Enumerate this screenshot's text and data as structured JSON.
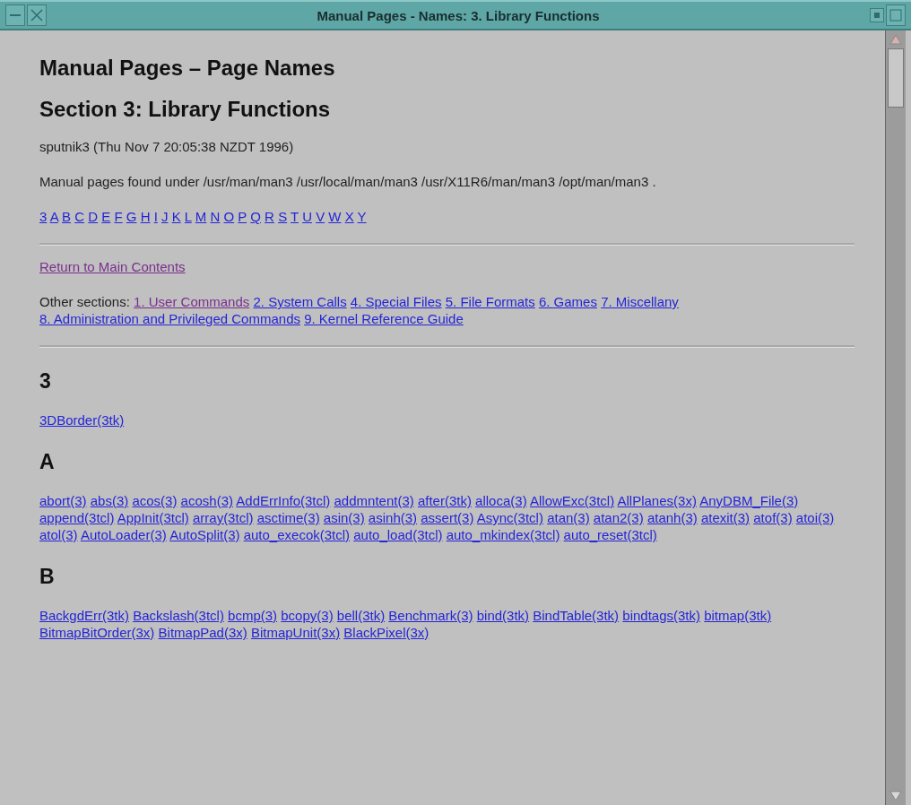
{
  "window": {
    "title": "Manual Pages - Names: 3. Library Functions"
  },
  "page": {
    "heading": "Manual Pages – Page Names",
    "subheading": "Section 3: Library Functions",
    "host_line": "sputnik3 (Thu Nov 7 20:05:38 NZDT 1996)",
    "paths_line": "Manual pages found under /usr/man/man3 /usr/local/man/man3 /usr/X11R6/man/man3 /opt/man/man3 .",
    "index_links": [
      "3",
      "A",
      "B",
      "C",
      "D",
      "E",
      "F",
      "G",
      "H",
      "I",
      "J",
      "K",
      "L",
      "M",
      "N",
      "O",
      "P",
      "Q",
      "R",
      "S",
      "T",
      "U",
      "V",
      "W",
      "X",
      "Y"
    ],
    "return_link": {
      "label": "Return to Main Contents",
      "visited": true
    },
    "other_sections": {
      "label": "Other sections:",
      "links": [
        {
          "label": "1. User Commands",
          "visited": true
        },
        {
          "label": "2. System Calls",
          "visited": false
        },
        {
          "label": "4. Special Files",
          "visited": false
        },
        {
          "label": "5. File Formats",
          "visited": false
        },
        {
          "label": "6. Games",
          "visited": false
        },
        {
          "label": "7. Miscellany",
          "visited": false
        },
        {
          "label": "8. Administration and Privileged Commands",
          "visited": false
        },
        {
          "label": "9. Kernel Reference Guide",
          "visited": false
        }
      ]
    },
    "groups": [
      {
        "letter": "3",
        "entries": [
          "3DBorder(3tk)"
        ]
      },
      {
        "letter": "A",
        "entries": [
          "abort(3)",
          "abs(3)",
          "acos(3)",
          "acosh(3)",
          "AddErrInfo(3tcl)",
          "addmntent(3)",
          "after(3tk)",
          "alloca(3)",
          "AllowExc(3tcl)",
          "AllPlanes(3x)",
          "AnyDBM_File(3)",
          "append(3tcl)",
          "AppInit(3tcl)",
          "array(3tcl)",
          "asctime(3)",
          "asin(3)",
          "asinh(3)",
          "assert(3)",
          "Async(3tcl)",
          "atan(3)",
          "atan2(3)",
          "atanh(3)",
          "atexit(3)",
          "atof(3)",
          "atoi(3)",
          "atol(3)",
          "AutoLoader(3)",
          "AutoSplit(3)",
          "auto_execok(3tcl)",
          "auto_load(3tcl)",
          "auto_mkindex(3tcl)",
          "auto_reset(3tcl)"
        ]
      },
      {
        "letter": "B",
        "entries": [
          "BackgdErr(3tk)",
          "Backslash(3tcl)",
          "bcmp(3)",
          "bcopy(3)",
          "bell(3tk)",
          "Benchmark(3)",
          "bind(3tk)",
          "BindTable(3tk)",
          "bindtags(3tk)",
          "bitmap(3tk)",
          "BitmapBitOrder(3x)",
          "BitmapPad(3x)",
          "BitmapUnit(3x)",
          "BlackPixel(3x)"
        ]
      }
    ]
  }
}
